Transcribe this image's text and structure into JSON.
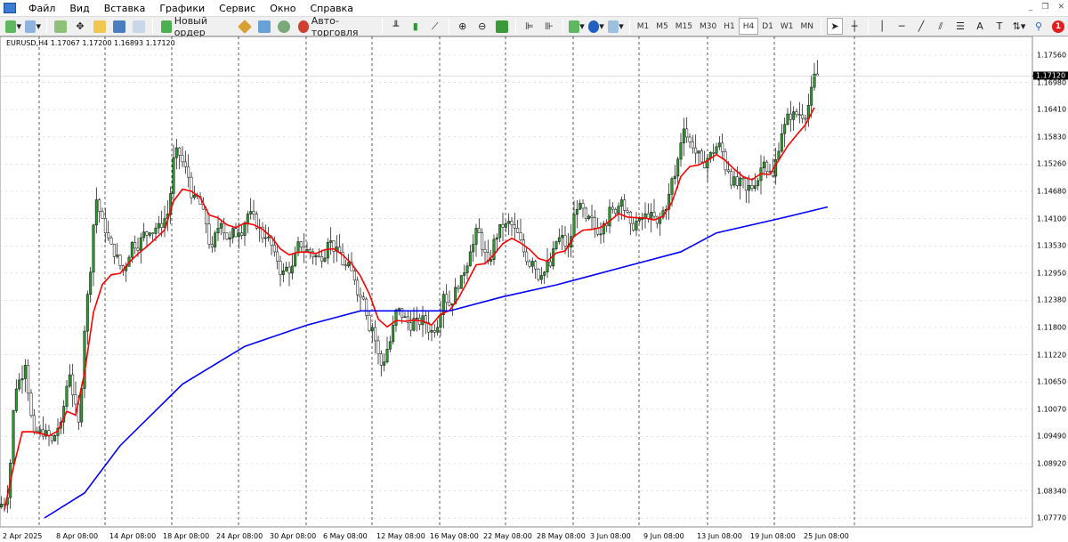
{
  "menu": [
    "Файл",
    "Вид",
    "Вставка",
    "Графики",
    "Сервис",
    "Окно",
    "Справка"
  ],
  "toolbar": {
    "new_order": "Новый ордер",
    "autotrading": "Авто-торговля",
    "timeframes": [
      "M1",
      "M5",
      "M15",
      "M30",
      "H1",
      "H4",
      "D1",
      "W1",
      "MN"
    ],
    "active_timeframe": "H4",
    "notification_count": "1"
  },
  "chart": {
    "symbol_info": "EURUSD,H4  1.17067 1.17200 1.16893 1.17120",
    "current_price": "1.17120",
    "price_labels": [
      "1.17560",
      "1.16980",
      "1.16410",
      "1.15830",
      "1.15260",
      "1.14680",
      "1.14100",
      "1.13530",
      "1.12950",
      "1.12380",
      "1.11800",
      "1.11220",
      "1.10650",
      "1.10070",
      "1.09490",
      "1.08920",
      "1.08340",
      "1.07770"
    ],
    "time_labels": [
      "2 Apr 2025",
      "8 Apr 08:00",
      "14 Apr 08:00",
      "18 Apr 08:00",
      "24 Apr 08:00",
      "30 Apr 08:00",
      "6 May 08:00",
      "12 May 08:00",
      "16 May 08:00",
      "22 May 08:00",
      "28 May 08:00",
      "3 Jun 08:00",
      "9 Jun 08:00",
      "13 Jun 08:00",
      "19 Jun 08:00",
      "25 Jun 08:00"
    ]
  },
  "chart_data": {
    "type": "line",
    "ylim": [
      1.0777,
      1.1756
    ],
    "colors": {
      "bull": "#2a9d2a",
      "bear": "#2a9d2a",
      "ma_fast": "#ff0000",
      "ma_slow": "#0000ff",
      "grid": "#c8c8d8"
    },
    "closes": [
      1.082,
      1.105,
      1.11,
      1.096,
      1.095,
      1.094,
      1.098,
      1.108,
      1.098,
      1.125,
      1.145,
      1.138,
      1.133,
      1.13,
      1.136,
      1.137,
      1.138,
      1.14,
      1.142,
      1.156,
      1.152,
      1.146,
      1.143,
      1.135,
      1.14,
      1.137,
      1.138,
      1.142,
      1.139,
      1.137,
      1.134,
      1.13,
      1.131,
      1.135,
      1.134,
      1.133,
      1.136,
      1.135,
      1.131,
      1.128,
      1.124,
      1.118,
      1.11,
      1.115,
      1.122,
      1.119,
      1.12,
      1.119,
      1.117,
      1.125,
      1.123,
      1.129,
      1.134,
      1.138,
      1.132,
      1.137,
      1.14,
      1.139,
      1.134,
      1.132,
      1.129,
      1.131,
      1.137,
      1.135,
      1.143,
      1.141,
      1.139,
      1.14,
      1.143,
      1.145,
      1.14,
      1.141,
      1.141,
      1.14,
      1.143,
      1.15,
      1.16,
      1.156,
      1.153,
      1.155,
      1.157,
      1.151,
      1.148,
      1.147,
      1.148,
      1.153,
      1.15,
      1.159,
      1.162,
      1.163,
      1.165,
      1.1712
    ],
    "ma_slow": [
      [
        4.5,
        1.0777
      ],
      [
        9,
        1.083
      ],
      [
        13,
        1.093
      ],
      [
        20,
        1.106
      ],
      [
        27,
        1.114
      ],
      [
        34,
        1.1185
      ],
      [
        40,
        1.1215
      ],
      [
        45,
        1.1215
      ],
      [
        50,
        1.1215
      ],
      [
        56,
        1.1245
      ],
      [
        62,
        1.127
      ],
      [
        70,
        1.131
      ],
      [
        76,
        1.134
      ],
      [
        80,
        1.138
      ],
      [
        87,
        1.141
      ],
      [
        92.5,
        1.1435
      ]
    ]
  }
}
